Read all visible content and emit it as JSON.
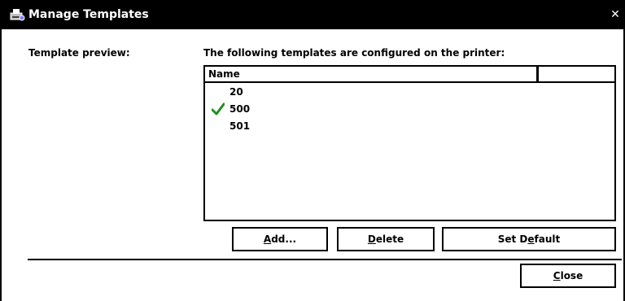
{
  "window": {
    "title": "Manage Templates",
    "close_glyph": "✕",
    "icon": "printer-settings-icon"
  },
  "labels": {
    "template_preview": "Template preview:",
    "templates_configured": "The following templates are configured on the printer:"
  },
  "list": {
    "columns": [
      "Name",
      ""
    ],
    "rows": [
      {
        "name": "20",
        "default": false
      },
      {
        "name": "500",
        "default": true
      },
      {
        "name": "501",
        "default": false
      }
    ],
    "default_check_color": "#1f8f1f"
  },
  "buttons": {
    "add": {
      "prefix": "",
      "mnemonic": "A",
      "suffix": "dd..."
    },
    "delete": {
      "prefix": "",
      "mnemonic": "D",
      "suffix": "elete"
    },
    "set_default": {
      "prefix": "Set D",
      "mnemonic": "e",
      "suffix": "fault"
    },
    "close": {
      "prefix": "",
      "mnemonic": "C",
      "suffix": "lose"
    }
  }
}
